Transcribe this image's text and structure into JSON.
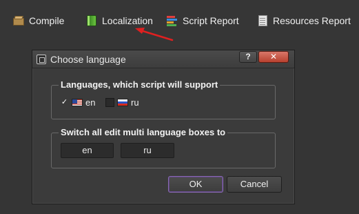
{
  "toolbar": {
    "compile": {
      "label": "Compile",
      "icon": "compile-icon"
    },
    "localization": {
      "label": "Localization",
      "icon": "localization-icon"
    },
    "script_report": {
      "label": "Script Report",
      "icon": "script-report-icon"
    },
    "resources_report": {
      "label": "Resources Report",
      "icon": "resources-report-icon"
    }
  },
  "dialog": {
    "title": "Choose language",
    "help_label": "?",
    "close_label": "✕",
    "languages_group": {
      "title": "Languages, which script will support",
      "items": [
        {
          "code": "en",
          "checked": true,
          "flag": "us-flag"
        },
        {
          "code": "ru",
          "checked": false,
          "flag": "ru-flag"
        }
      ]
    },
    "switch_group": {
      "title": "Switch all edit multi language boxes to",
      "buttons": [
        "en",
        "ru"
      ]
    },
    "ok_label": "OK",
    "cancel_label": "Cancel"
  },
  "colors": {
    "background": "#353535",
    "dialog_bg": "#3b3b3b",
    "annotation_arrow": "#e02020",
    "close_button": "#c4503e",
    "ok_focus": "#8a6bb3"
  }
}
